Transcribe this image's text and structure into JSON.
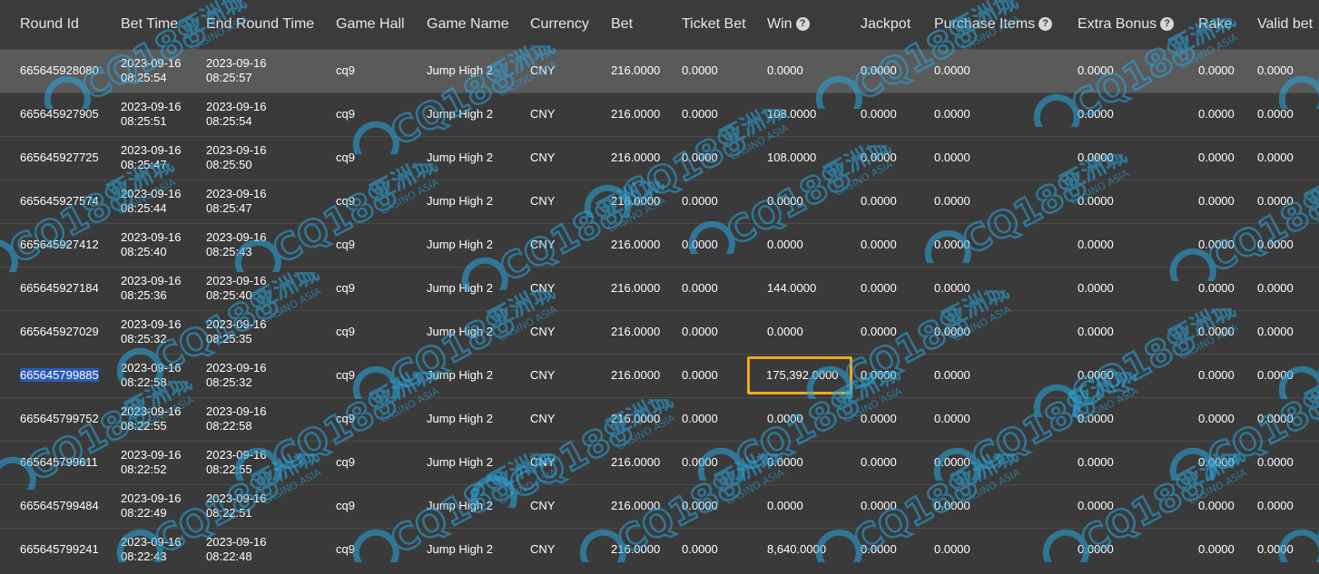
{
  "table": {
    "headers": [
      {
        "label": "Round Id",
        "help": false
      },
      {
        "label": "Bet Time",
        "help": false
      },
      {
        "label": "End Round Time",
        "help": false
      },
      {
        "label": "Game Hall",
        "help": false
      },
      {
        "label": "Game Name",
        "help": false
      },
      {
        "label": "Currency",
        "help": false
      },
      {
        "label": "Bet",
        "help": false
      },
      {
        "label": "Ticket Bet",
        "help": false
      },
      {
        "label": "Win",
        "help": true
      },
      {
        "label": "Jackpot",
        "help": false
      },
      {
        "label": "Purchase Items",
        "help": true
      },
      {
        "label": "Extra Bonus",
        "help": true
      },
      {
        "label": "Rake",
        "help": false
      },
      {
        "label": "Valid bet",
        "help": false
      }
    ],
    "help_glyph": "?",
    "rows": [
      {
        "round_id": "665645928080",
        "bet_date": "2023-09-16",
        "bet_time": "08:25:54",
        "end_date": "2023-09-16",
        "end_time": "08:25:57",
        "hall": "cq9",
        "game": "Jump High 2",
        "currency": "CNY",
        "bet": "216.0000",
        "ticket_bet": "0.0000",
        "win": "0.0000",
        "jackpot": "0.0000",
        "purchase_items": "0.0000",
        "extra_bonus": "0.0000",
        "rake": "0.0000",
        "valid_bet": "0.0000",
        "highlighted": true,
        "selected": false,
        "win_boxed": false
      },
      {
        "round_id": "665645927905",
        "bet_date": "2023-09-16",
        "bet_time": "08:25:51",
        "end_date": "2023-09-16",
        "end_time": "08:25:54",
        "hall": "cq9",
        "game": "Jump High 2",
        "currency": "CNY",
        "bet": "216.0000",
        "ticket_bet": "0.0000",
        "win": "108.0000",
        "jackpot": "0.0000",
        "purchase_items": "0.0000",
        "extra_bonus": "0.0000",
        "rake": "0.0000",
        "valid_bet": "0.0000",
        "highlighted": false,
        "selected": false,
        "win_boxed": false
      },
      {
        "round_id": "665645927725",
        "bet_date": "2023-09-16",
        "bet_time": "08:25:47",
        "end_date": "2023-09-16",
        "end_time": "08:25:50",
        "hall": "cq9",
        "game": "Jump High 2",
        "currency": "CNY",
        "bet": "216.0000",
        "ticket_bet": "0.0000",
        "win": "108.0000",
        "jackpot": "0.0000",
        "purchase_items": "0.0000",
        "extra_bonus": "0.0000",
        "rake": "0.0000",
        "valid_bet": "0.0000",
        "highlighted": false,
        "selected": false,
        "win_boxed": false
      },
      {
        "round_id": "665645927574",
        "bet_date": "2023-09-16",
        "bet_time": "08:25:44",
        "end_date": "2023-09-16",
        "end_time": "08:25:47",
        "hall": "cq9",
        "game": "Jump High 2",
        "currency": "CNY",
        "bet": "216.0000",
        "ticket_bet": "0.0000",
        "win": "0.0000",
        "jackpot": "0.0000",
        "purchase_items": "0.0000",
        "extra_bonus": "0.0000",
        "rake": "0.0000",
        "valid_bet": "0.0000",
        "highlighted": false,
        "selected": false,
        "win_boxed": false
      },
      {
        "round_id": "665645927412",
        "bet_date": "2023-09-16",
        "bet_time": "08:25:40",
        "end_date": "2023-09-16",
        "end_time": "08:25:43",
        "hall": "cq9",
        "game": "Jump High 2",
        "currency": "CNY",
        "bet": "216.0000",
        "ticket_bet": "0.0000",
        "win": "0.0000",
        "jackpot": "0.0000",
        "purchase_items": "0.0000",
        "extra_bonus": "0.0000",
        "rake": "0.0000",
        "valid_bet": "0.0000",
        "highlighted": false,
        "selected": false,
        "win_boxed": false
      },
      {
        "round_id": "665645927184",
        "bet_date": "2023-09-16",
        "bet_time": "08:25:36",
        "end_date": "2023-09-16",
        "end_time": "08:25:40",
        "hall": "cq9",
        "game": "Jump High 2",
        "currency": "CNY",
        "bet": "216.0000",
        "ticket_bet": "0.0000",
        "win": "144.0000",
        "jackpot": "0.0000",
        "purchase_items": "0.0000",
        "extra_bonus": "0.0000",
        "rake": "0.0000",
        "valid_bet": "0.0000",
        "highlighted": false,
        "selected": false,
        "win_boxed": false
      },
      {
        "round_id": "665645927029",
        "bet_date": "2023-09-16",
        "bet_time": "08:25:32",
        "end_date": "2023-09-16",
        "end_time": "08:25:35",
        "hall": "cq9",
        "game": "Jump High 2",
        "currency": "CNY",
        "bet": "216.0000",
        "ticket_bet": "0.0000",
        "win": "0.0000",
        "jackpot": "0.0000",
        "purchase_items": "0.0000",
        "extra_bonus": "0.0000",
        "rake": "0.0000",
        "valid_bet": "0.0000",
        "highlighted": false,
        "selected": false,
        "win_boxed": false
      },
      {
        "round_id": "665645799885",
        "bet_date": "2023-09-16",
        "bet_time": "08:22:58",
        "end_date": "2023-09-16",
        "end_time": "08:25:32",
        "hall": "cq9",
        "game": "Jump High 2",
        "currency": "CNY",
        "bet": "216.0000",
        "ticket_bet": "0.0000",
        "win": "175,392.0000",
        "jackpot": "0.0000",
        "purchase_items": "0.0000",
        "extra_bonus": "0.0000",
        "rake": "0.0000",
        "valid_bet": "0.0000",
        "highlighted": false,
        "selected": true,
        "win_boxed": true
      },
      {
        "round_id": "665645799752",
        "bet_date": "2023-09-16",
        "bet_time": "08:22:55",
        "end_date": "2023-09-16",
        "end_time": "08:22:58",
        "hall": "cq9",
        "game": "Jump High 2",
        "currency": "CNY",
        "bet": "216.0000",
        "ticket_bet": "0.0000",
        "win": "0.0000",
        "jackpot": "0.0000",
        "purchase_items": "0.0000",
        "extra_bonus": "0.0000",
        "rake": "0.0000",
        "valid_bet": "0.0000",
        "highlighted": false,
        "selected": false,
        "win_boxed": false
      },
      {
        "round_id": "665645799611",
        "bet_date": "2023-09-16",
        "bet_time": "08:22:52",
        "end_date": "2023-09-16",
        "end_time": "08:22:55",
        "hall": "cq9",
        "game": "Jump High 2",
        "currency": "CNY",
        "bet": "216.0000",
        "ticket_bet": "0.0000",
        "win": "0.0000",
        "jackpot": "0.0000",
        "purchase_items": "0.0000",
        "extra_bonus": "0.0000",
        "rake": "0.0000",
        "valid_bet": "0.0000",
        "highlighted": false,
        "selected": false,
        "win_boxed": false
      },
      {
        "round_id": "665645799484",
        "bet_date": "2023-09-16",
        "bet_time": "08:22:49",
        "end_date": "2023-09-16",
        "end_time": "08:22:51",
        "hall": "cq9",
        "game": "Jump High 2",
        "currency": "CNY",
        "bet": "216.0000",
        "ticket_bet": "0.0000",
        "win": "0.0000",
        "jackpot": "0.0000",
        "purchase_items": "0.0000",
        "extra_bonus": "0.0000",
        "rake": "0.0000",
        "valid_bet": "0.0000",
        "highlighted": false,
        "selected": false,
        "win_boxed": false
      },
      {
        "round_id": "665645799241",
        "bet_date": "2023-09-16",
        "bet_time": "08:22:43",
        "end_date": "2023-09-16",
        "end_time": "08:22:48",
        "hall": "cq9",
        "game": "Jump High 2",
        "currency": "CNY",
        "bet": "216.0000",
        "ticket_bet": "0.0000",
        "win": "8,640.0000",
        "jackpot": "0.0000",
        "purchase_items": "0.0000",
        "extra_bonus": "0.0000",
        "rake": "0.0000",
        "valid_bet": "0.0000",
        "highlighted": false,
        "selected": false,
        "win_boxed": false
      }
    ]
  },
  "watermark": {
    "brand": "CQ188",
    "cn_text": "亚洲城",
    "sub_text": "CASINO ASIA",
    "color": "#2aa8e0"
  },
  "colors": {
    "background": "#3a3a3a",
    "row_highlight": "#5a5a5a",
    "selection": "#2a5ab8",
    "win_box_border": "#f0a91a"
  }
}
